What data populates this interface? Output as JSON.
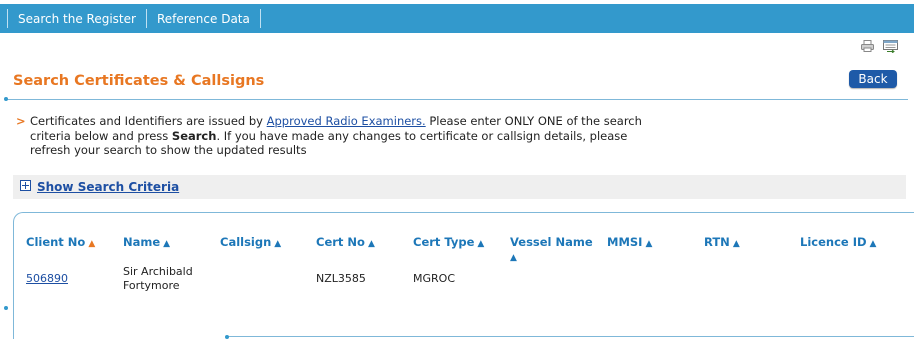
{
  "nav": {
    "items": [
      {
        "label": "Search the Register"
      },
      {
        "label": "Reference Data"
      }
    ]
  },
  "toolbar": {
    "icons": [
      "printer-icon",
      "export-icon"
    ]
  },
  "page": {
    "title": "Search Certificates & Callsigns",
    "back_label": "Back"
  },
  "intro": {
    "prefix": "Certificates and Identifiers are issued by ",
    "link": "Approved Radio Examiners.",
    "mid": " Please enter ONLY ONE of the search criteria below and press ",
    "bold": "Search",
    "suffix": ". If you have made any changes to certificate or callsign details, please refresh your search to show the updated results"
  },
  "criteria": {
    "toggle_label": "Show Search Criteria"
  },
  "table": {
    "columns": [
      {
        "label": "Client No",
        "sort_active": true
      },
      {
        "label": "Name"
      },
      {
        "label": "Callsign"
      },
      {
        "label": "Cert No"
      },
      {
        "label": "Cert Type"
      },
      {
        "label": "Vessel Name"
      },
      {
        "label": "MMSI"
      },
      {
        "label": "RTN"
      },
      {
        "label": "Licence ID"
      }
    ],
    "rows": [
      {
        "client_no": "506890",
        "name_line1": "Sir Archibald",
        "name_line2": "Fortymore",
        "callsign": "",
        "cert_no": "NZL3585",
        "cert_type": "MGROC",
        "vessel_name": "",
        "mmsi": "",
        "rtn": "",
        "licence_id": ""
      }
    ]
  },
  "colors": {
    "nav_bg": "#3399cc",
    "title": "#e87722",
    "link": "#1d4fa3",
    "header": "#1d77b8",
    "button": "#1e5aa8"
  }
}
